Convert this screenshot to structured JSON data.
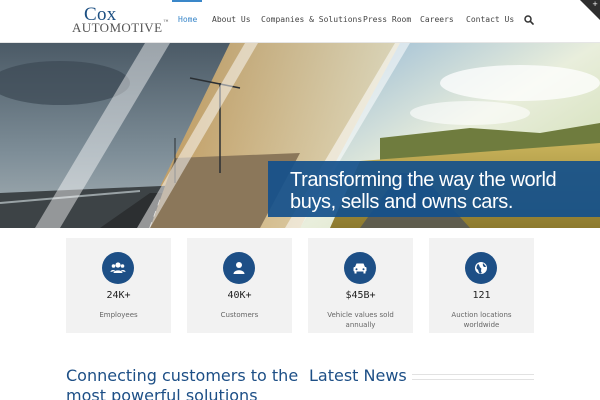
{
  "header": {
    "logo": {
      "line1": "Cox",
      "line2": "AUTOMOTIVE",
      "trademark": "™"
    },
    "nav": [
      {
        "label": "Home",
        "active": true
      },
      {
        "label": "About Us",
        "active": false
      },
      {
        "label": "Companies & Solutions",
        "active": false
      },
      {
        "label": "Press Room",
        "active": false
      },
      {
        "label": "Careers",
        "active": false
      },
      {
        "label": "Contact Us",
        "active": false
      }
    ],
    "search_icon": "search-icon",
    "corner_icon": "plus-icon",
    "accent_color": "#3a87c9"
  },
  "hero": {
    "headline_line1": "Transforming the way the world",
    "headline_line2": "buys, sells and owns cars.",
    "banner_color": "#14508c"
  },
  "stats": [
    {
      "icon": "users-icon",
      "value": "24K+",
      "label": "Employees"
    },
    {
      "icon": "person-icon",
      "value": "40K+",
      "label": "Customers"
    },
    {
      "icon": "car-icon",
      "value": "$45B+",
      "label": "Vehicle values sold annually"
    },
    {
      "icon": "globe-icon",
      "value": "121",
      "label": "Auction locations worldwide"
    }
  ],
  "sections": {
    "connecting_title": "Connecting customers to the most powerful solutions",
    "latest_news_title": "Latest News"
  },
  "colors": {
    "brand": "#1d4f86",
    "card_bg": "#f2f2f2"
  }
}
